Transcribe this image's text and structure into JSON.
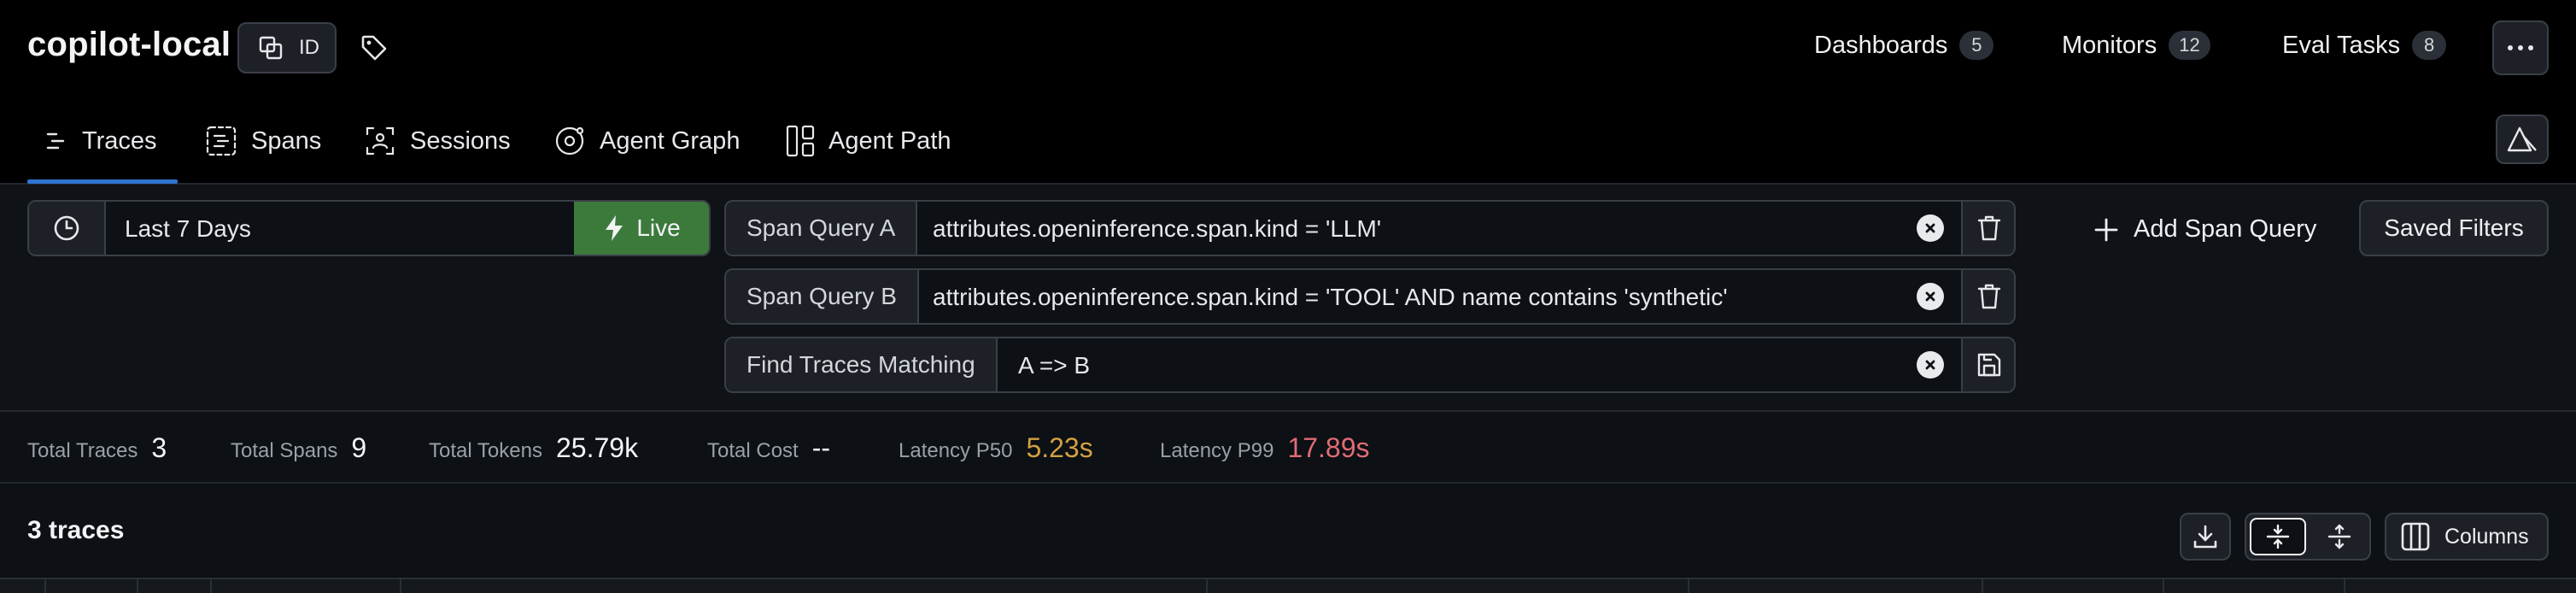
{
  "header": {
    "project_name": "copilot-local",
    "id_button_label": "ID",
    "nav_links": [
      {
        "label": "Dashboards",
        "count": "5"
      },
      {
        "label": "Monitors",
        "count": "12"
      },
      {
        "label": "Eval Tasks",
        "count": "8"
      }
    ]
  },
  "tabs": [
    {
      "label": "Traces",
      "icon": "traces-icon",
      "active": true
    },
    {
      "label": "Spans",
      "icon": "spans-icon",
      "active": false
    },
    {
      "label": "Sessions",
      "icon": "sessions-icon",
      "active": false
    },
    {
      "label": "Agent Graph",
      "icon": "agent-graph-icon",
      "active": false
    },
    {
      "label": "Agent Path",
      "icon": "agent-path-icon",
      "active": false
    }
  ],
  "filters": {
    "time_range": "Last 7 Days",
    "live_label": "Live",
    "queries": [
      {
        "label": "Span Query A",
        "value": "attributes.openinference.span.kind = 'LLM'"
      },
      {
        "label": "Span Query B",
        "value": "attributes.openinference.span.kind = 'TOOL' AND name contains 'synthetic'"
      },
      {
        "label": "Find Traces Matching",
        "value": "A => B"
      }
    ],
    "add_query_label": "Add Span Query",
    "saved_filters_label": "Saved Filters"
  },
  "stats": [
    {
      "label": "Total Traces",
      "value": "3"
    },
    {
      "label": "Total Spans",
      "value": "9"
    },
    {
      "label": "Total Tokens",
      "value": "25.79k"
    },
    {
      "label": "Total Cost",
      "value": "--"
    },
    {
      "label": "Latency P50",
      "value": "5.23s"
    },
    {
      "label": "Latency P99",
      "value": "17.89s"
    }
  ],
  "traces": {
    "count_label": "3 traces",
    "columns_label": "Columns"
  },
  "colors": {
    "accent": "#2f74d0",
    "live": "#3c7a3c",
    "latency_p50": "#d3a142",
    "latency_p99": "#e06c75"
  }
}
